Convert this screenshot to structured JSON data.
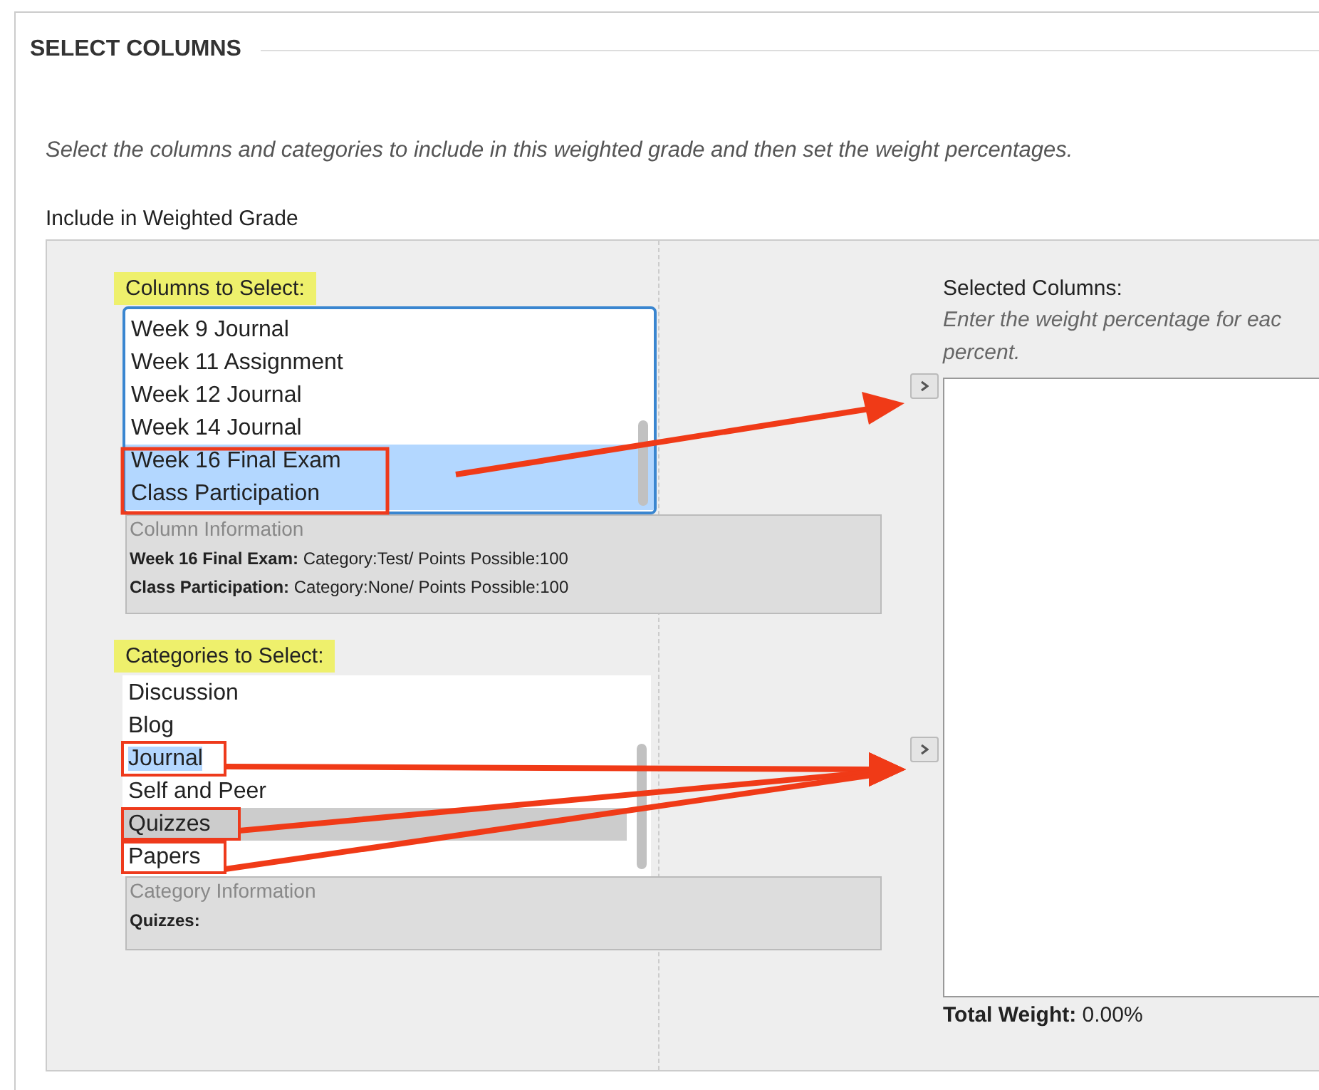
{
  "section": {
    "title": "SELECT COLUMNS"
  },
  "intro": "Select the columns and categories to include in this weighted grade and then set the weight percentages.",
  "include_label": "Include in Weighted Grade",
  "columns": {
    "label": "Columns to Select:",
    "highlighted": true,
    "items": [
      {
        "label": "Week 9 Journal",
        "selected": false
      },
      {
        "label": "Week 11 Assignment",
        "selected": false
      },
      {
        "label": "Week 12 Journal",
        "selected": false
      },
      {
        "label": "Week 14 Journal",
        "selected": false
      },
      {
        "label": "Week 16 Final Exam",
        "selected": true
      },
      {
        "label": "Class Participation",
        "selected": true
      }
    ],
    "info": {
      "title": "Column Information",
      "lines": [
        {
          "name": "Week 16 Final Exam:",
          "text": "Category:Test/ Points Possible:100"
        },
        {
          "name": "Class Participation:",
          "text": "Category:None/ Points Possible:100"
        }
      ]
    }
  },
  "categories": {
    "label": "Categories to Select:",
    "highlighted": true,
    "items": [
      {
        "label": "Discussion",
        "selected": false,
        "text_selected": false
      },
      {
        "label": "Blog",
        "selected": false,
        "text_selected": false
      },
      {
        "label": "Journal",
        "selected": false,
        "text_selected": true
      },
      {
        "label": "Self and Peer",
        "selected": false,
        "text_selected": false
      },
      {
        "label": "Quizzes",
        "selected": true,
        "text_selected": false
      },
      {
        "label": "Papers",
        "selected": false,
        "text_selected": false
      }
    ],
    "info": {
      "title": "Category Information",
      "lines": [
        {
          "name": "Quizzes:"
        }
      ]
    }
  },
  "selected_columns": {
    "label": "Selected Columns:",
    "hint_lines": [
      "Enter the weight percentage for eac",
      "percent."
    ]
  },
  "total_weight": {
    "label": "Total Weight:",
    "value": "0.00%"
  }
}
